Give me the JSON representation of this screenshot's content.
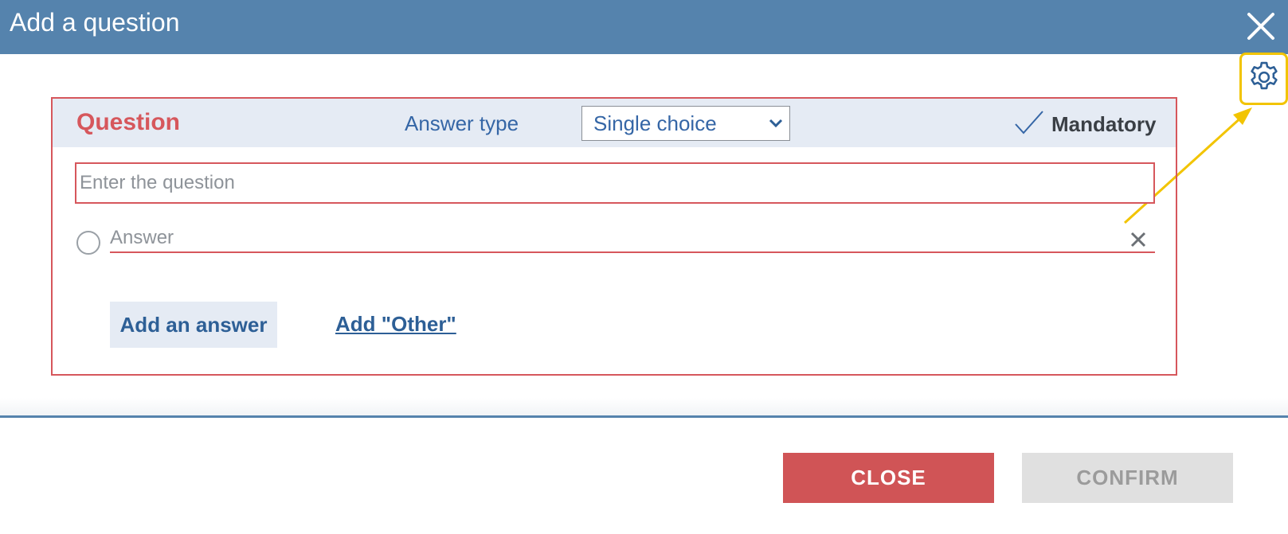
{
  "dialog": {
    "title": "Add a question"
  },
  "icons": {
    "close": "close-icon",
    "settings": "gear-icon",
    "select_arrow": "chevron-down-icon",
    "mandatory": "checkmark-icon",
    "remove_answer": "close-icon",
    "answer_radio": "radio-icon"
  },
  "question": {
    "label": "Question",
    "answer_type_label": "Answer type",
    "answer_type_value": "Single choice",
    "mandatory_label": "Mandatory",
    "question_placeholder": "Enter the question",
    "answer_placeholder": "Answer",
    "add_answer_label": "Add an answer",
    "add_other_label": "Add \"Other\""
  },
  "footer": {
    "close_label": "CLOSE",
    "confirm_label": "CONFIRM"
  },
  "colors": {
    "header_bg": "#5583ad",
    "accent_red": "#d6575c",
    "link_blue": "#2d5f96",
    "highlight_yellow": "#f2c400",
    "panel_bg": "#e5ebf4"
  }
}
